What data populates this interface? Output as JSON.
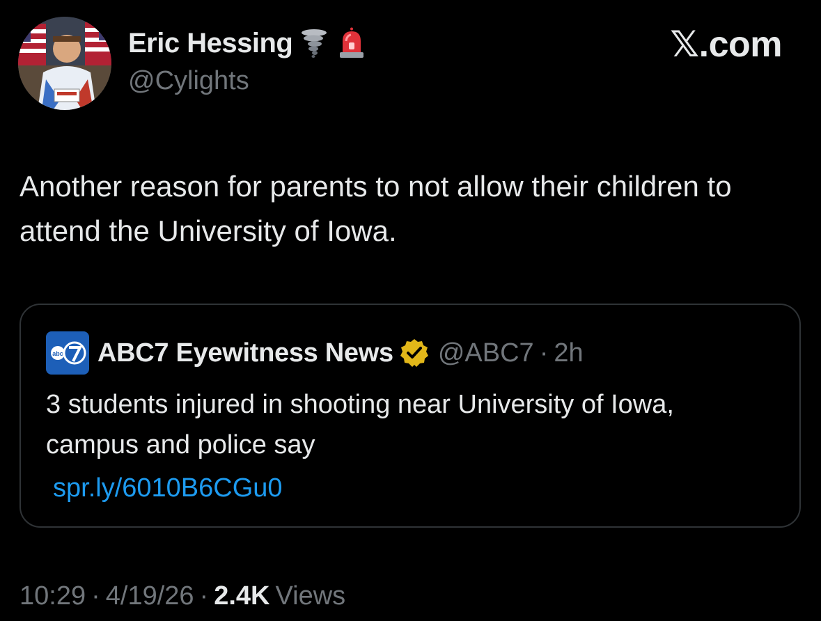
{
  "author": {
    "display_name": "Eric Hessing",
    "handle": "@Cylights",
    "emojis": [
      "tornado-icon",
      "siren-icon"
    ]
  },
  "brand": "𝕏.com",
  "tweet": {
    "text": "Another reason for parents to not allow their children to attend the University of Iowa."
  },
  "quoted_tweet": {
    "display_name": "ABC7 Eyewitness News",
    "verified": "gold-checkmark",
    "handle": "@ABC7",
    "dot": "·",
    "time": "2h",
    "text": "3 students injured in shooting near University of Iowa, campus and police say",
    "link": "spr.ly/6010B6CGu0"
  },
  "meta": {
    "time": "10:29",
    "date": "4/19/26",
    "dot": "·",
    "views_count": "2.4K",
    "views_label": "Views"
  },
  "colors": {
    "background": "#000000",
    "text": "#e7e9ea",
    "muted": "#71767b",
    "link": "#1d9bf0",
    "border": "#2f3336",
    "gold": "#e2b719"
  }
}
